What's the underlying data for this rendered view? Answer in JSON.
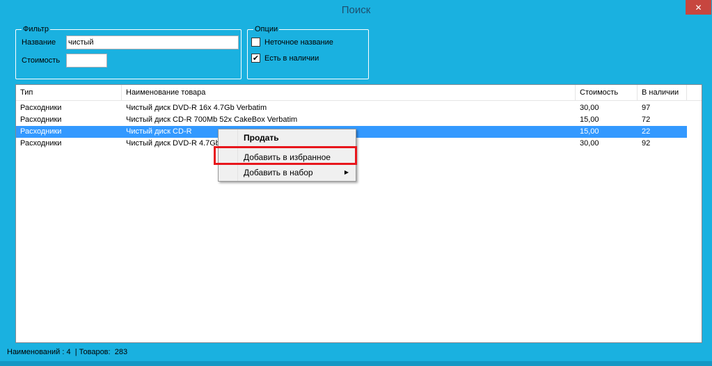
{
  "window": {
    "title": "Поиск",
    "close_glyph": "✕"
  },
  "filter": {
    "legend": "Фильтр",
    "name_label": "Название",
    "name_value": "чистый",
    "cost_label": "Стоимость",
    "cost_value": ""
  },
  "options": {
    "legend": "Опции",
    "fuzzy_label": "Неточное название",
    "fuzzy_checked": false,
    "instock_label": "Есть в наличии",
    "instock_checked": true
  },
  "table": {
    "columns": [
      "Тип",
      "Наименование товара",
      "Стоимость",
      "В наличии"
    ],
    "rows": [
      {
        "type": "Расходники",
        "name": "Чистый диск DVD-R 16x 4.7Gb Verbatim",
        "cost": "30,00",
        "stock": "97"
      },
      {
        "type": "Расходники",
        "name": "Чистый диск CD-R 700Mb 52x CakeBox Verbatim",
        "cost": "15,00",
        "stock": "72"
      },
      {
        "type": "Расходники",
        "name": "Чистый диск CD-R",
        "cost": "15,00",
        "stock": "22"
      },
      {
        "type": "Расходники",
        "name": "Чистый диск DVD-R 4.7Gb",
        "cost": "30,00",
        "stock": "92"
      }
    ],
    "selected_index": 2
  },
  "context_menu": {
    "items": [
      {
        "label": "Продать"
      },
      {
        "label": "Добавить в избранное"
      },
      {
        "label": "Добавить в набор"
      }
    ],
    "submenu_arrow": "▶"
  },
  "status": {
    "names_label": "Наименований :",
    "names_count": "4",
    "goods_label": "| Товаров:",
    "goods_count": "283"
  }
}
